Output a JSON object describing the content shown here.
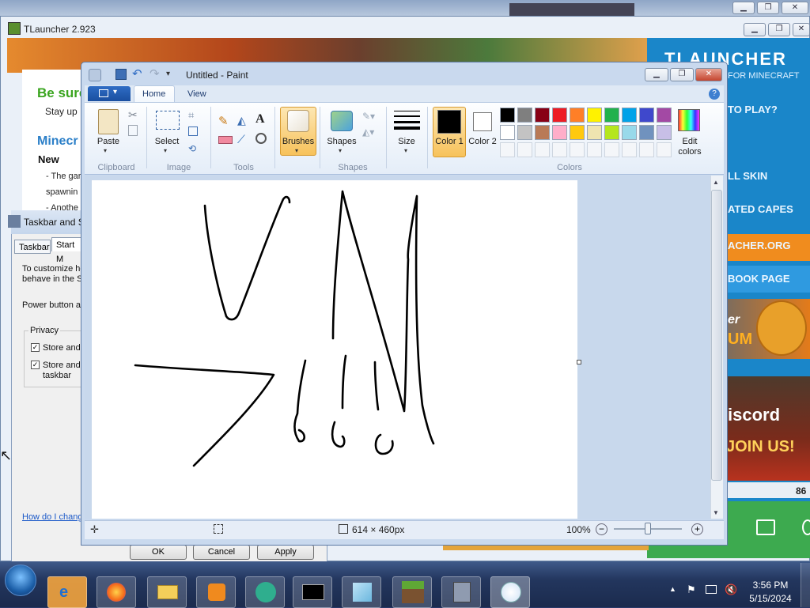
{
  "tlauncher": {
    "title": "TLauncher 2.923",
    "heading1": "Be sure",
    "text1": "Stay up",
    "heading2": "Minecr",
    "subheading": "New",
    "text2": "- The gar",
    "text3": "spawnin",
    "text4": "- Anothe",
    "logo": "TLAUNCHER",
    "logo_sub": "FOR MINECRAFT",
    "right_items": [
      "TO PLAY?",
      "LL SKIN",
      "ATED CAPES",
      "ACHER.ORG",
      "BOOK PAGE"
    ],
    "promo_a": "er",
    "promo_b": "UM",
    "discord": "iscord",
    "join": "JOIN US!",
    "footer_num": "86"
  },
  "dialog": {
    "title": "Taskbar and S",
    "tabs": [
      "Taskbar",
      "Start M"
    ],
    "line1": "To customize ho",
    "line2": "behave in the S",
    "power": "Power button a",
    "privacy": "Privacy",
    "chk1": "Store and",
    "chk2a": "Store and",
    "chk2b": "taskbar",
    "link": "How do I chang",
    "buttons": {
      "ok": "OK",
      "cancel": "Cancel",
      "apply": "Apply"
    }
  },
  "paint": {
    "title": "Untitled - Paint",
    "tabs": {
      "home": "Home",
      "view": "View"
    },
    "paste": "Paste",
    "select": "Select",
    "brushes": "Brushes",
    "shapes": "Shapes",
    "size": "Size",
    "color1": "Color 1",
    "color2": "Color 2",
    "edit_colors": "Edit colors",
    "groups": {
      "clipboard": "Clipboard",
      "image": "Image",
      "tools": "Tools",
      "shapes": "Shapes",
      "colors": "Colors"
    },
    "palette_row1": [
      "#000000",
      "#7f7f7f",
      "#880015",
      "#ed1c24",
      "#ff7f27",
      "#fff200",
      "#22b14c",
      "#00a2e8",
      "#3f48cc",
      "#a349a4"
    ],
    "palette_row2": [
      "#ffffff",
      "#c3c3c3",
      "#b97a57",
      "#ffaec9",
      "#ffc90e",
      "#efe4b0",
      "#b5e61d",
      "#99d9ea",
      "#7092be",
      "#c8bfe7"
    ],
    "status_size": "614 × 460px",
    "zoom": "100%"
  },
  "taskbar": {
    "time": "3:56 PM",
    "date": "5/15/2024"
  }
}
